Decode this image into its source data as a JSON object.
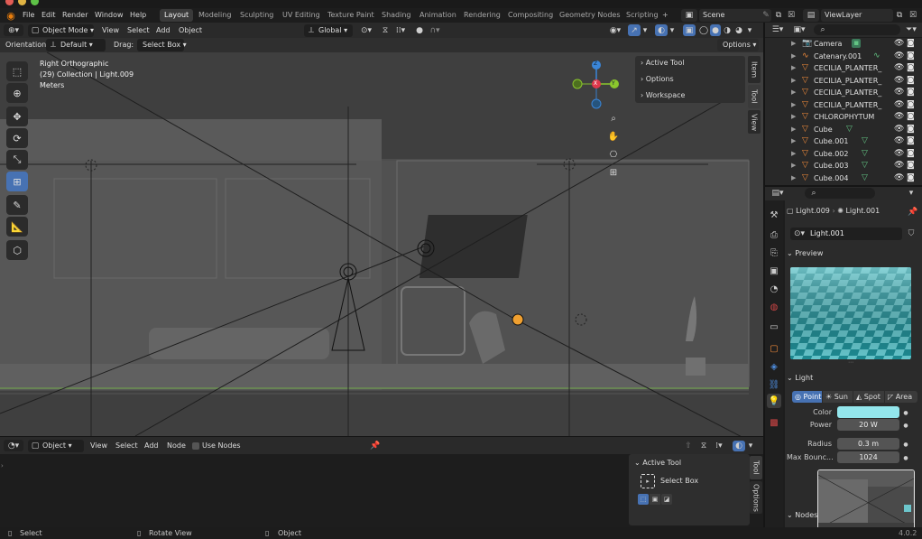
{
  "menubar": {
    "items": [
      "File",
      "Edit",
      "Render",
      "Window",
      "Help"
    ],
    "workspaces": [
      "Layout",
      "Modeling",
      "Sculpting",
      "UV Editing",
      "Texture Paint",
      "Shading",
      "Animation",
      "Rendering",
      "Compositing",
      "Geometry Nodes",
      "Scripting"
    ],
    "active_workspace": "Layout",
    "add_tab": "+",
    "scene": "Scene",
    "view_layer": "ViewLayer"
  },
  "viewport_header": {
    "mode": "Object Mode",
    "menus": [
      "View",
      "Select",
      "Add",
      "Object"
    ],
    "transform_orientation": "Global",
    "orientation_label": "Orientation:",
    "orientation_value": "Default",
    "drag_label": "Drag:",
    "drag_value": "Select Box",
    "options": "Options"
  },
  "viewport": {
    "view_name": "Right Orthographic",
    "collection_info": "(29) Collection | Light.009",
    "units": "Meters",
    "gizmo": {
      "x": "X",
      "y": "Y",
      "z": "Z"
    },
    "npanel": {
      "rows": [
        "Active Tool",
        "Options",
        "Workspace"
      ],
      "tabs": [
        "Item",
        "Tool",
        "View"
      ]
    }
  },
  "outliner": {
    "rows": [
      {
        "name": "Camera",
        "icon": "camera-icon",
        "extra": "camera-data-icon"
      },
      {
        "name": "Catenary.001",
        "icon": "curve-icon",
        "extra": "curve-data-icon"
      },
      {
        "name": "CECILIA_PLANTER_",
        "icon": "mesh-icon",
        "extra": ""
      },
      {
        "name": "CECILIA_PLANTER_",
        "icon": "mesh-icon",
        "extra": ""
      },
      {
        "name": "CECILIA_PLANTER_",
        "icon": "mesh-icon",
        "extra": ""
      },
      {
        "name": "CECILIA_PLANTER_",
        "icon": "mesh-icon",
        "extra": ""
      },
      {
        "name": "CHLOROPHYTUM",
        "icon": "mesh-icon",
        "extra": ""
      },
      {
        "name": "Cube",
        "icon": "mesh-icon",
        "extra": "mesh-data-icon"
      },
      {
        "name": "Cube.001",
        "icon": "mesh-icon",
        "extra": "mesh-data-icon"
      },
      {
        "name": "Cube.002",
        "icon": "mesh-icon",
        "extra": "mesh-data-icon"
      },
      {
        "name": "Cube.003",
        "icon": "mesh-icon",
        "extra": "mesh-data-icon"
      },
      {
        "name": "Cube.004",
        "icon": "mesh-icon",
        "extra": "mesh-data-icon"
      }
    ]
  },
  "properties": {
    "breadcrumb_object": "Light.009",
    "breadcrumb_data": "Light.001",
    "datablock": "Light.001",
    "preview_title": "Preview",
    "light_title": "Light",
    "light_types": [
      "Point",
      "Sun",
      "Spot",
      "Area"
    ],
    "active_light_type": "Point",
    "color_label": "Color",
    "color_value": "#93e6ec",
    "power_label": "Power",
    "power_value": "20 W",
    "radius_label": "Radius",
    "radius_value": "0.3 m",
    "max_bounces_label": "Max Bounc...",
    "max_bounces_value": "1024",
    "nodes_label": "Nodes"
  },
  "shader_editor": {
    "mode": "Object",
    "menus": [
      "View",
      "Select",
      "Add",
      "Node"
    ],
    "use_nodes": "Use Nodes",
    "active_tool_title": "Active Tool",
    "active_tool_name": "Select Box",
    "side_tabs": [
      "Tool",
      "Options"
    ]
  },
  "statusbar": {
    "items": [
      "Select",
      "Rotate View",
      "Object"
    ],
    "version": "4.0.2"
  },
  "colors": {
    "accent": "#4772b3",
    "gizmo_x": "#e0394c",
    "gizmo_y": "#8bc72d",
    "gizmo_z": "#3a86d9",
    "mesh_icon": "#f08a3a",
    "data_icon": "#63c383"
  }
}
